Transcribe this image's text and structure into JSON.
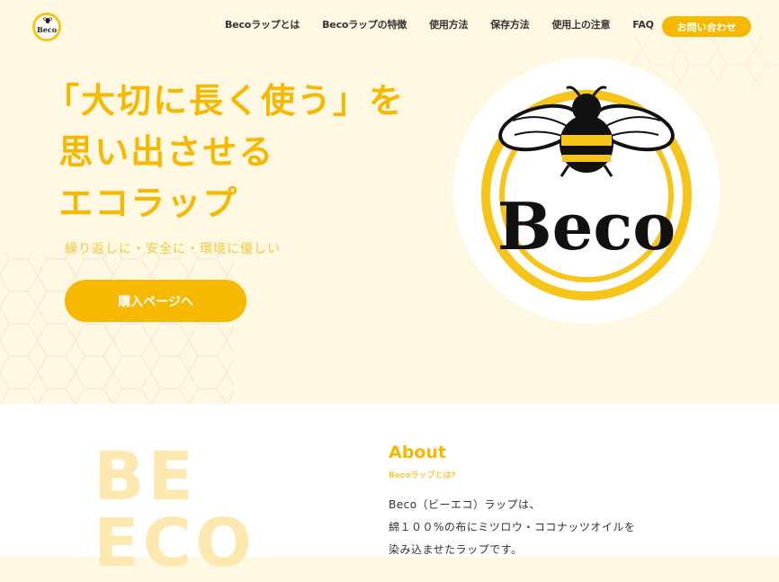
{
  "header": {
    "logo_text": "Beco",
    "nav": [
      "Becoラップとは",
      "Becoラップの特徴",
      "使用方法",
      "保存方法",
      "使用上の注意",
      "FAQ"
    ],
    "contact_label": "お問い合わせ"
  },
  "hero": {
    "title_line1": "「大切に長く使う」を",
    "title_line2": " 思い出させる",
    "title_line3": " エコラップ",
    "subtitle": "繰り返しに・安全に・環境に優しい",
    "buy_label": "購入ページへ",
    "logo_text": "Beco"
  },
  "about": {
    "bg_text_line1": "BE",
    "bg_text_line2": "ECO",
    "title": "About",
    "subtitle": "Becoラップとは?",
    "text_line1": "Beco（ビーエコ）ラップは、",
    "text_line2": "綿１００%の布にミツロウ・ココナッツオイルを",
    "text_line3": "染み込ませたラップです。"
  },
  "colors": {
    "accent": "#f7b800",
    "hero_bg": "#fff8e3",
    "text": "#333333"
  }
}
